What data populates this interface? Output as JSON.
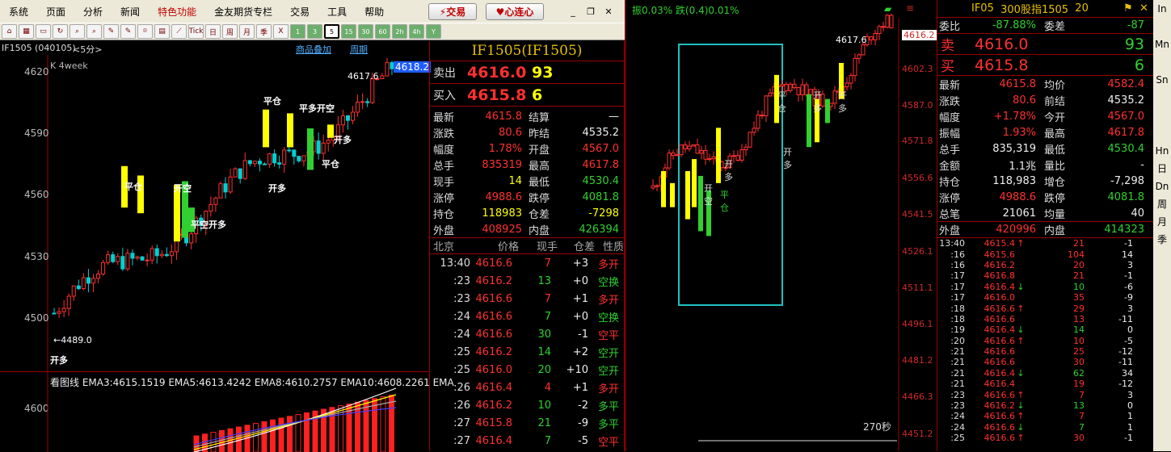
{
  "menu": [
    "系统",
    "页面",
    "分析",
    "新闻",
    "特色功能",
    "金友期货专栏",
    "交易",
    "工具",
    "帮助"
  ],
  "buttons": {
    "trade": "交易",
    "connect": "心连心"
  },
  "toolbar": [
    "⌂",
    "▦",
    "▭",
    "↻",
    "⌕",
    "⌕",
    "✎",
    "✎",
    "⌾",
    "▤",
    "⟋",
    "Tick",
    "日",
    "周",
    "月",
    "季",
    "X",
    "1",
    "3",
    "5",
    "15",
    "30",
    "60",
    "2h",
    "4h",
    "Y"
  ],
  "chart": {
    "symbol": "IF1505 (040105)",
    "period": "<5分>",
    "overlay_link": "商品叠加",
    "cycle_link": "周期",
    "klabel": "K  4week",
    "last_price": "4618.2",
    "high_mark": "4617.6",
    "low_mark": "←4489.0",
    "ticks": [
      "4620",
      "4590",
      "4560",
      "4530",
      "4500"
    ],
    "annotations": [
      "平仓",
      "平多开空",
      "开多",
      "平仓",
      "开空",
      "开多",
      "平空开多",
      "平仓",
      "开多"
    ],
    "ema_legend": "看图线  EMA3:4615.1519  EMA5:4613.4242  EMA8:4610.2757  EMA10:4608.2261  EMA",
    "ema_tick": "4600"
  },
  "chart_data": {
    "type": "candlestick",
    "title": "IF1505 (040105)",
    "period": "<5分>",
    "ylim": [
      4489,
      4620
    ],
    "series": [
      {
        "name": "K",
        "values": []
      }
    ],
    "last": 4618.2,
    "high": 4617.6,
    "low": 4489.0
  },
  "quote": {
    "title": "IF1505(IF1505)",
    "ask_label": "卖出",
    "ask_price": "4616.0",
    "ask_vol": "93",
    "bid_label": "买入",
    "bid_price": "4615.8",
    "bid_vol": "6",
    "stats": [
      [
        "最新",
        "4615.8",
        "结算",
        "—"
      ],
      [
        "涨跌",
        "80.6",
        "昨结",
        "4535.2"
      ],
      [
        "幅度",
        "1.78%",
        "开盘",
        "4567.0"
      ],
      [
        "总手",
        "835319",
        "最高",
        "4617.8"
      ],
      [
        "现手",
        "14",
        "最低",
        "4530.4"
      ],
      [
        "涨停",
        "4988.6",
        "跌停",
        "4081.8"
      ],
      [
        "持仓",
        "118983",
        "仓差",
        "-7298"
      ],
      [
        "外盘",
        "408925",
        "内盘",
        "426394"
      ]
    ],
    "tick_head": [
      "北京",
      "价格",
      "现手",
      "仓差",
      "性质"
    ],
    "ticks": [
      [
        "13:40",
        "4616.6",
        "7",
        "+3",
        "多开"
      ],
      [
        ":23",
        "4616.2",
        "13",
        "+0",
        "空换"
      ],
      [
        ":23",
        "4616.6",
        "7",
        "+1",
        "多开"
      ],
      [
        ":24",
        "4616.6",
        "7",
        "+0",
        "空换"
      ],
      [
        ":24",
        "4616.6",
        "30",
        "-1",
        "空平"
      ],
      [
        ":25",
        "4616.2",
        "14",
        "+2",
        "空开"
      ],
      [
        ":25",
        "4616.0",
        "20",
        "+10",
        "空开"
      ],
      [
        ":26",
        "4616.4",
        "4",
        "+1",
        "多开"
      ],
      [
        ":26",
        "4616.2",
        "10",
        "-2",
        "多平"
      ],
      [
        ":27",
        "4615.8",
        "21",
        "-9",
        "多平"
      ],
      [
        ":27",
        "4616.4",
        "7",
        "-5",
        "空平"
      ]
    ]
  },
  "rt": {
    "head": "振0.03%  跌(0.4)0.01%",
    "price_tag": "4616.2",
    "high_mark": "4617.6",
    "ticks": [
      "4602.3",
      "4587.0",
      "4571.8",
      "4556.6",
      "4541.5",
      "4526.1",
      "4511.1",
      "4496.1",
      "4481.2",
      "4466.3",
      "4451.2"
    ],
    "annots": [
      "开多",
      "开空",
      "平仓",
      "平仓",
      "开多",
      "开多",
      "开多"
    ],
    "timer": "270秒"
  },
  "panel": {
    "code": "IF05",
    "name": "300股指1505",
    "num": "20",
    "wb": [
      "委比",
      "-87.88%",
      "委差",
      "-87"
    ],
    "sell_label": "卖",
    "sell_price": "4616.0",
    "sell_vol": "93",
    "buy_label": "买",
    "buy_price": "4615.8",
    "buy_vol": "6",
    "stats": [
      [
        "最新",
        "4615.8",
        "均价",
        "4582.4"
      ],
      [
        "涨跌",
        "80.6",
        "前结",
        "4535.2"
      ],
      [
        "幅度",
        "+1.78%",
        "今开",
        "4567.0"
      ],
      [
        "振幅",
        "1.93%",
        "最高",
        "4617.8"
      ],
      [
        "总手",
        "835,319",
        "最低",
        "4530.4"
      ],
      [
        "金额",
        "1.1兆",
        "量比",
        "-"
      ],
      [
        "持仓",
        "118,983",
        "增仓",
        "-7,298"
      ],
      [
        "涨停",
        "4988.6",
        "跌停",
        "4081.8"
      ],
      [
        "总笔",
        "21061",
        "均量",
        "40"
      ],
      [
        "外盘",
        "420996",
        "内盘",
        "414323"
      ]
    ],
    "ticks": [
      [
        "13:40",
        "4615.4",
        "↑",
        "21",
        "-1"
      ],
      [
        ":16",
        "4615.6",
        "",
        "104",
        "14"
      ],
      [
        ":16",
        "4616.2",
        "",
        "20",
        "3"
      ],
      [
        ":17",
        "4616.8",
        "",
        "21",
        "-1"
      ],
      [
        ":17",
        "4616.4",
        "↓",
        "10",
        "-6"
      ],
      [
        ":17",
        "4616.0",
        "",
        "35",
        "-9"
      ],
      [
        ":18",
        "4616.6",
        "↑",
        "29",
        "3"
      ],
      [
        ":18",
        "4616.6",
        "",
        "13",
        "-11"
      ],
      [
        ":19",
        "4616.4",
        "↓",
        "14",
        "0"
      ],
      [
        ":20",
        "4616.6",
        "↑",
        "10",
        "-5"
      ],
      [
        ":21",
        "4616.6",
        "",
        "25",
        "-12"
      ],
      [
        ":21",
        "4616.6",
        "",
        "30",
        "-11"
      ],
      [
        ":21",
        "4616.4",
        "↓",
        "62",
        "34"
      ],
      [
        ":21",
        "4616.4",
        "",
        "19",
        "-12"
      ],
      [
        ":23",
        "4616.6",
        "↑",
        "7",
        "3"
      ],
      [
        ":23",
        "4616.2",
        "↓",
        "13",
        "0"
      ],
      [
        ":24",
        "4616.6",
        "↑",
        "7",
        "1"
      ],
      [
        ":24",
        "4616.6",
        "↓",
        "7",
        "1"
      ],
      [
        ":25",
        "4616.6",
        "↑",
        "30",
        "-1"
      ]
    ]
  },
  "sidebar": [
    "In",
    "",
    "Mn",
    "",
    "Sn",
    "",
    "",
    "",
    "Hn",
    "日",
    "Dn",
    "周",
    "月",
    "季"
  ]
}
